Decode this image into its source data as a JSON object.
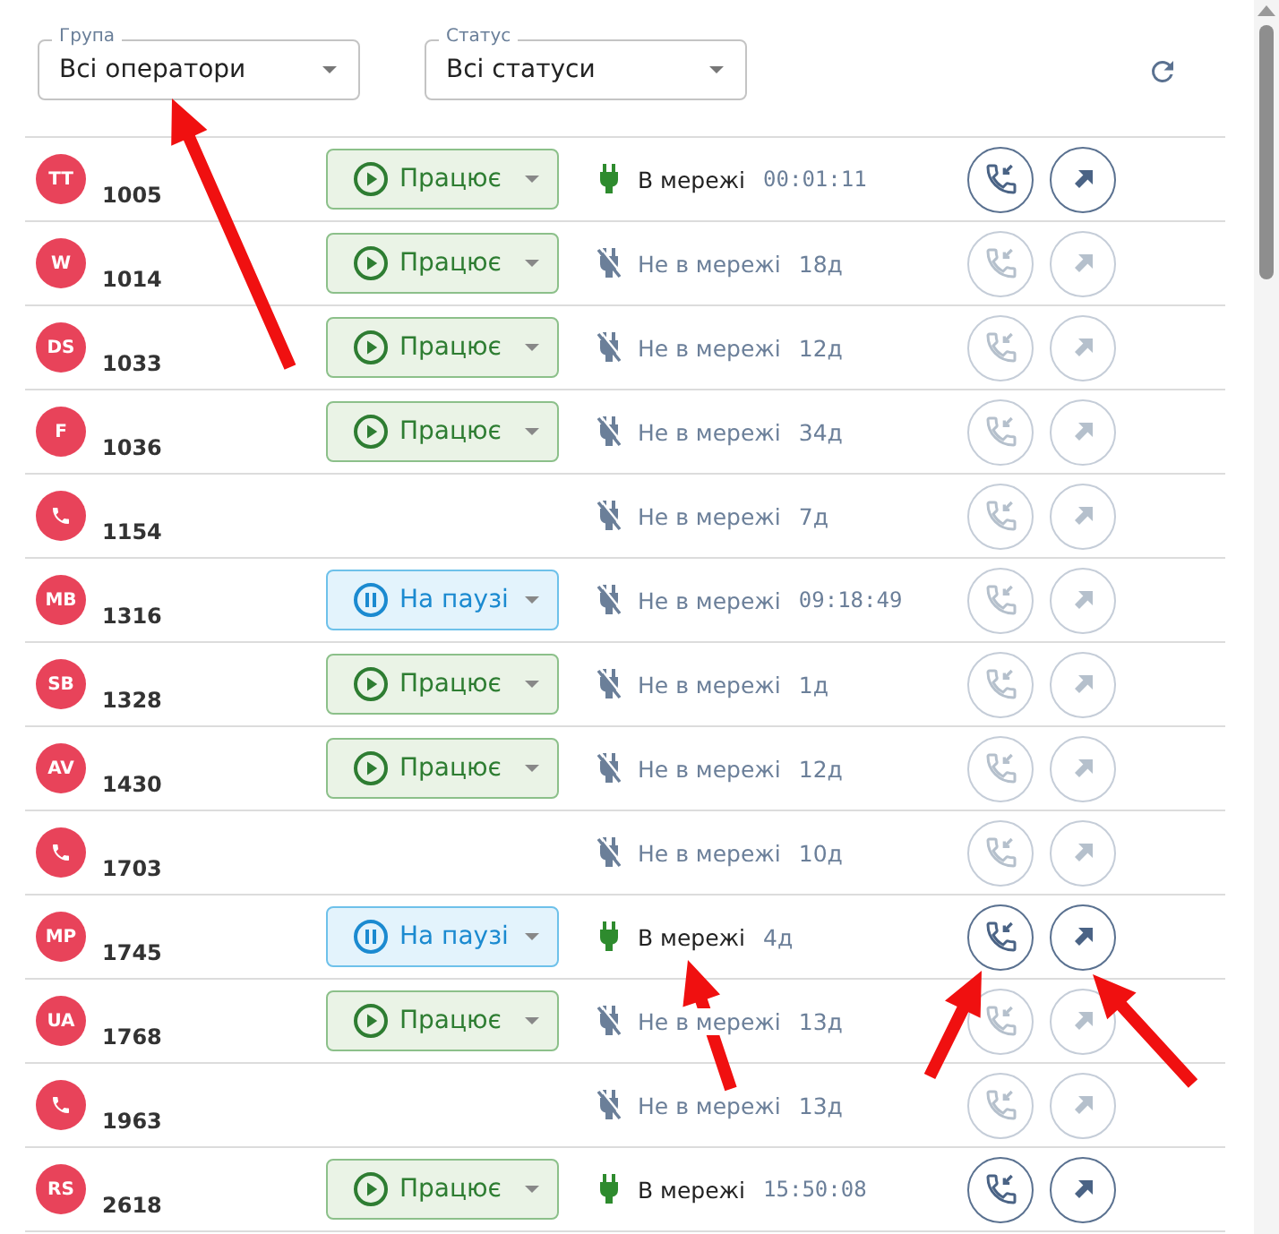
{
  "filters": [
    {
      "label": "Група",
      "value": "Всі оператори"
    },
    {
      "label": "Статус",
      "value": "Всі статуси"
    }
  ],
  "operators": [
    {
      "avatar": {
        "kind": "initials",
        "text": "TT"
      },
      "extension": "1005",
      "status": {
        "kind": "working",
        "label": "Працює"
      },
      "online": true,
      "network_label": "В мережі",
      "duration": "00:01:11",
      "timer": true
    },
    {
      "avatar": {
        "kind": "initials",
        "text": "W"
      },
      "extension": "1014",
      "status": {
        "kind": "working",
        "label": "Працює"
      },
      "online": false,
      "network_label": "Не в мережі",
      "duration": "18д",
      "timer": false
    },
    {
      "avatar": {
        "kind": "initials",
        "text": "DS"
      },
      "extension": "1033",
      "status": {
        "kind": "working",
        "label": "Працює"
      },
      "online": false,
      "network_label": "Не в мережі",
      "duration": "12д",
      "timer": false
    },
    {
      "avatar": {
        "kind": "initials",
        "text": "F"
      },
      "extension": "1036",
      "status": {
        "kind": "working",
        "label": "Працює"
      },
      "online": false,
      "network_label": "Не в мережі",
      "duration": "34д",
      "timer": false
    },
    {
      "avatar": {
        "kind": "phone"
      },
      "extension": "1154",
      "online": false,
      "network_label": "Не в мережі",
      "duration": "7д",
      "timer": false
    },
    {
      "avatar": {
        "kind": "initials",
        "text": "MB"
      },
      "extension": "1316",
      "status": {
        "kind": "paused",
        "label": "На паузі"
      },
      "online": false,
      "network_label": "Не в мережі",
      "duration": "09:18:49",
      "timer": true
    },
    {
      "avatar": {
        "kind": "initials",
        "text": "SB"
      },
      "extension": "1328",
      "status": {
        "kind": "working",
        "label": "Працює"
      },
      "online": false,
      "network_label": "Не в мережі",
      "duration": "1д",
      "timer": false
    },
    {
      "avatar": {
        "kind": "initials",
        "text": "AV"
      },
      "extension": "1430",
      "status": {
        "kind": "working",
        "label": "Працює"
      },
      "online": false,
      "network_label": "Не в мережі",
      "duration": "12д",
      "timer": false
    },
    {
      "avatar": {
        "kind": "phone"
      },
      "extension": "1703",
      "online": false,
      "network_label": "Не в мережі",
      "duration": "10д",
      "timer": false
    },
    {
      "avatar": {
        "kind": "initials",
        "text": "MP"
      },
      "extension": "1745",
      "status": {
        "kind": "paused",
        "label": "На паузі"
      },
      "online": true,
      "network_label": "В мережі",
      "duration": "4д",
      "timer": false
    },
    {
      "avatar": {
        "kind": "initials",
        "text": "UA"
      },
      "extension": "1768",
      "status": {
        "kind": "working",
        "label": "Працює"
      },
      "online": false,
      "network_label": "Не в мережі",
      "duration": "13д",
      "timer": false
    },
    {
      "avatar": {
        "kind": "phone"
      },
      "extension": "1963",
      "online": false,
      "network_label": "Не в мережі",
      "duration": "13д",
      "timer": false
    },
    {
      "avatar": {
        "kind": "initials",
        "text": "RS"
      },
      "extension": "2618",
      "status": {
        "kind": "working",
        "label": "Працює"
      },
      "online": true,
      "network_label": "В мережі",
      "duration": "15:50:08",
      "timer": true
    }
  ]
}
